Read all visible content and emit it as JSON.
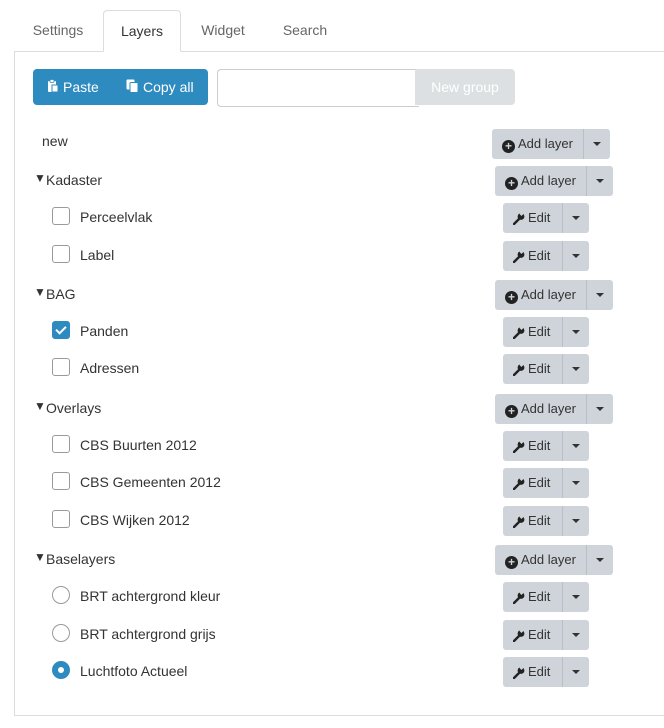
{
  "tabs": [
    {
      "label": "Settings",
      "active": false
    },
    {
      "label": "Layers",
      "active": true
    },
    {
      "label": "Widget",
      "active": false
    },
    {
      "label": "Search",
      "active": false
    }
  ],
  "toolbar": {
    "paste_label": "Paste",
    "copy_all_label": "Copy all",
    "group_input_value": "",
    "new_group_label": "New group"
  },
  "rows": [
    {
      "kind": "group",
      "label": "new",
      "expanded": null,
      "action": "Add layer"
    },
    {
      "kind": "group",
      "label": "Kadaster",
      "expanded": true,
      "action": "Add layer"
    },
    {
      "kind": "checkbox",
      "label": "Perceelvlak",
      "checked": false,
      "action": "Edit"
    },
    {
      "kind": "checkbox",
      "label": "Label",
      "checked": false,
      "action": "Edit"
    },
    {
      "kind": "group",
      "label": "BAG",
      "expanded": true,
      "action": "Add layer"
    },
    {
      "kind": "checkbox",
      "label": "Panden",
      "checked": true,
      "action": "Edit"
    },
    {
      "kind": "checkbox",
      "label": "Adressen",
      "checked": false,
      "action": "Edit"
    },
    {
      "kind": "group",
      "label": "Overlays",
      "expanded": true,
      "action": "Add layer"
    },
    {
      "kind": "checkbox",
      "label": "CBS Buurten 2012",
      "checked": false,
      "action": "Edit"
    },
    {
      "kind": "checkbox",
      "label": "CBS Gemeenten 2012",
      "checked": false,
      "action": "Edit"
    },
    {
      "kind": "checkbox",
      "label": "CBS Wijken 2012",
      "checked": false,
      "action": "Edit"
    },
    {
      "kind": "group",
      "label": "Baselayers",
      "expanded": true,
      "action": "Add layer"
    },
    {
      "kind": "radio",
      "label": "BRT achtergrond kleur",
      "checked": false,
      "action": "Edit"
    },
    {
      "kind": "radio",
      "label": "BRT achtergrond grijs",
      "checked": false,
      "action": "Edit"
    },
    {
      "kind": "radio",
      "label": "Luchtfoto Actueel",
      "checked": true,
      "action": "Edit"
    }
  ],
  "toggle_glyph": "▼",
  "colors": {
    "accent": "#2e8bc0",
    "button_gray": "#ced4da",
    "disabled": "#dde0e3"
  }
}
